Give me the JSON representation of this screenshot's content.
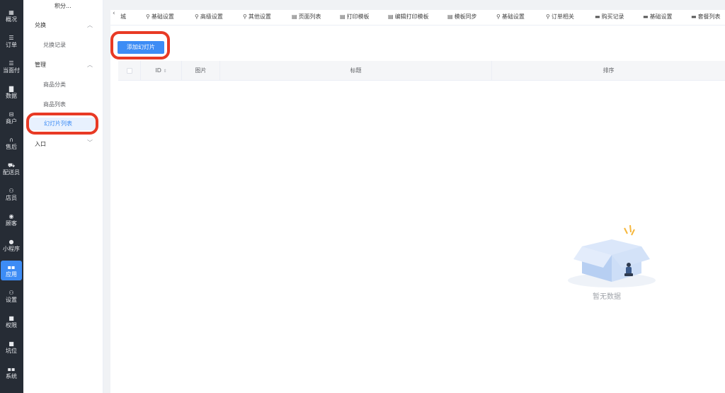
{
  "rail": {
    "items": [
      {
        "label": "概况",
        "icon": "▦"
      },
      {
        "label": "订单",
        "icon": "☰"
      },
      {
        "label": "当面付",
        "icon": "☰"
      },
      {
        "label": "数据",
        "icon": "▇"
      },
      {
        "label": "商户",
        "icon": "⊟"
      },
      {
        "label": "售后",
        "icon": "∩"
      },
      {
        "label": "配送员",
        "icon": "⛟"
      },
      {
        "label": "店员",
        "icon": "⚇"
      },
      {
        "label": "顾客",
        "icon": "◉"
      },
      {
        "label": "小程序",
        "icon": "●"
      },
      {
        "label": "应用",
        "icon": "▪▪"
      },
      {
        "label": "设置",
        "icon": "⚇"
      },
      {
        "label": "权限",
        "icon": "■"
      },
      {
        "label": "坑位",
        "icon": "■"
      },
      {
        "label": "系统",
        "icon": "▪▪"
      }
    ],
    "active_index": 10
  },
  "submenu": {
    "top_text": "积分...",
    "groups": [
      {
        "label": "兑换",
        "chevron": "up",
        "items": [
          "兑换记录"
        ]
      },
      {
        "label": "管理",
        "chevron": "up",
        "items": [
          "商品分类",
          "商品列表",
          "幻灯片列表"
        ]
      },
      {
        "label": "入口",
        "chevron": "down",
        "items": []
      }
    ],
    "active_item": "幻灯片列表"
  },
  "tabs": {
    "back": "‹",
    "items": [
      {
        "label": "城",
        "icon": ""
      },
      {
        "label": "基础设置",
        "icon": "user"
      },
      {
        "label": "高级设置",
        "icon": "user"
      },
      {
        "label": "其他设置",
        "icon": "user"
      },
      {
        "label": "页面列表",
        "icon": "doc"
      },
      {
        "label": "打印模板",
        "icon": "doc"
      },
      {
        "label": "编辑打印模板",
        "icon": "doc"
      },
      {
        "label": "模板同步",
        "icon": "doc"
      },
      {
        "label": "基础设置",
        "icon": "user"
      },
      {
        "label": "订单相关",
        "icon": "user"
      },
      {
        "label": "购买记录",
        "icon": "card"
      },
      {
        "label": "基础设置",
        "icon": "card"
      },
      {
        "label": "套餐列表",
        "icon": "card"
      }
    ]
  },
  "main": {
    "add_button": "添加幻灯片",
    "columns": [
      "ID",
      "图片",
      "标题",
      "排序"
    ],
    "empty_text": "暂无数据"
  },
  "colors": {
    "primary": "#3d8cf5",
    "highlight": "#e83a25",
    "rail_bg": "#262c35"
  }
}
